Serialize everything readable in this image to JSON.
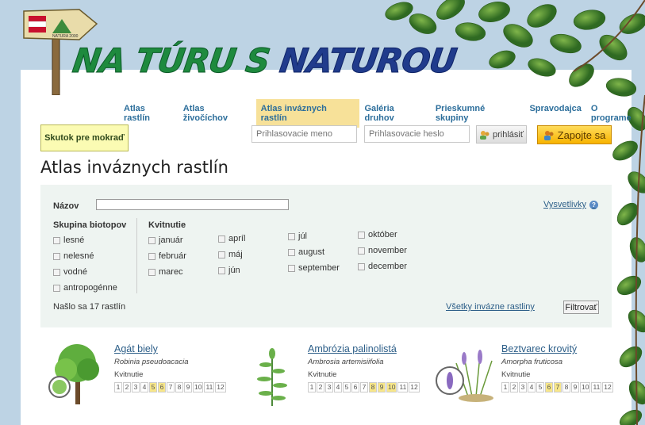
{
  "brand": {
    "logo_left": "NA TÚRU S",
    "logo_right": "NATUROU",
    "sign_text": "NATURA 2000"
  },
  "nav": [
    {
      "label": "Atlas rastlín",
      "active": false
    },
    {
      "label": "Atlas živočíchov",
      "active": false
    },
    {
      "label": "Atlas inváznych rastlín",
      "active": true
    },
    {
      "label": "Galéria druhov",
      "active": false
    },
    {
      "label": "Prieskumné skupiny",
      "active": false
    },
    {
      "label": "Spravodajca",
      "active": false
    },
    {
      "label": "O programe",
      "active": false
    }
  ],
  "tip_label": "Skutok pre mokraď",
  "login": {
    "user_placeholder": "Prihlasovacie meno",
    "pass_placeholder": "Prihlasovacie heslo",
    "button": "prihlásiť"
  },
  "join_label": "Zapojte sa",
  "page_title": "Atlas inváznych rastlín",
  "filter": {
    "name_label": "Názov",
    "name_value": "",
    "legend_link": "Vysvetlivky",
    "biotope_title": "Skupina biotopov",
    "biotopes": [
      "lesné",
      "nelesné",
      "vodné",
      "antropogénne"
    ],
    "bloom_title": "Kvitnutie",
    "months_col1": [
      "január",
      "február",
      "marec"
    ],
    "months_col2": [
      "apríl",
      "máj",
      "jún"
    ],
    "months_col3": [
      "júl",
      "august",
      "september"
    ],
    "months_col4": [
      "október",
      "november",
      "december"
    ],
    "count_text": "Našlo sa 17 rastlín",
    "all_link": "Všetky invázne rastliny",
    "filter_button": "Filtrovať"
  },
  "plants": [
    {
      "name": "Agát biely",
      "latin": "Robinia pseudoacacia",
      "flower_label": "Kvitnutie",
      "active_months": [
        5,
        6
      ]
    },
    {
      "name": "Ambrózia palinolistá",
      "latin": "Ambrosia artemisiifolia",
      "flower_label": "Kvitnutie",
      "active_months": [
        8,
        9,
        10
      ]
    },
    {
      "name": "Beztvarec krovitý",
      "latin": "Amorpha fruticosa",
      "flower_label": "Kvitnutie",
      "active_months": [
        6,
        7
      ]
    }
  ],
  "colors": {
    "accent": "#2c6e9b",
    "nav_active_bg": "#f7e199",
    "join_bg": "#f7b300",
    "filter_bg": "#eef4f1",
    "month_on": "#f8e78a"
  }
}
